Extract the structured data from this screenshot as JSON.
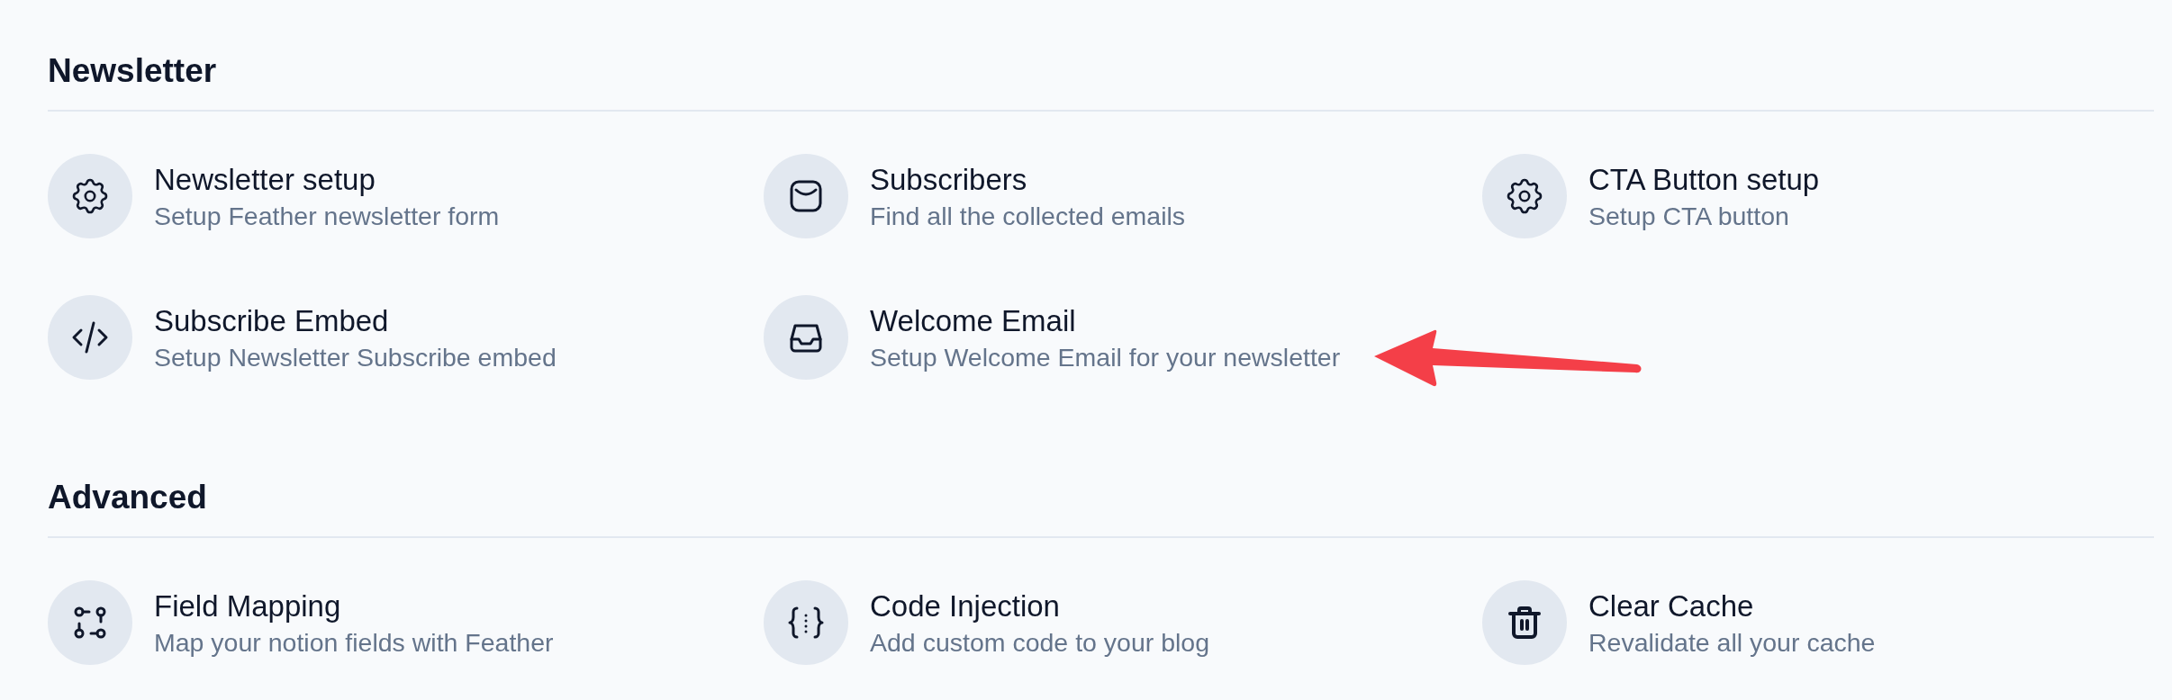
{
  "sections": [
    {
      "title": "Newsletter",
      "items": [
        {
          "kind": "setup",
          "title": "Newsletter setup",
          "description": "Setup Feather newsletter form"
        },
        {
          "kind": "subscribers",
          "title": "Subscribers",
          "description": "Find all the collected emails"
        },
        {
          "kind": "setup",
          "title": "CTA Button setup",
          "description": "Setup CTA button"
        },
        {
          "kind": "embed",
          "title": "Subscribe Embed",
          "description": "Setup Newsletter Subscribe embed"
        },
        {
          "kind": "email",
          "title": "Welcome Email",
          "description": "Setup Welcome Email for your newsletter"
        }
      ]
    },
    {
      "title": "Advanced",
      "items": [
        {
          "kind": "mapping",
          "title": "Field Mapping",
          "description": "Map your notion fields with Feather"
        },
        {
          "kind": "injection",
          "title": "Code Injection",
          "description": "Add custom code to your blog"
        },
        {
          "kind": "cache",
          "title": "Clear Cache",
          "description": "Revalidate all your cache"
        }
      ]
    }
  ]
}
